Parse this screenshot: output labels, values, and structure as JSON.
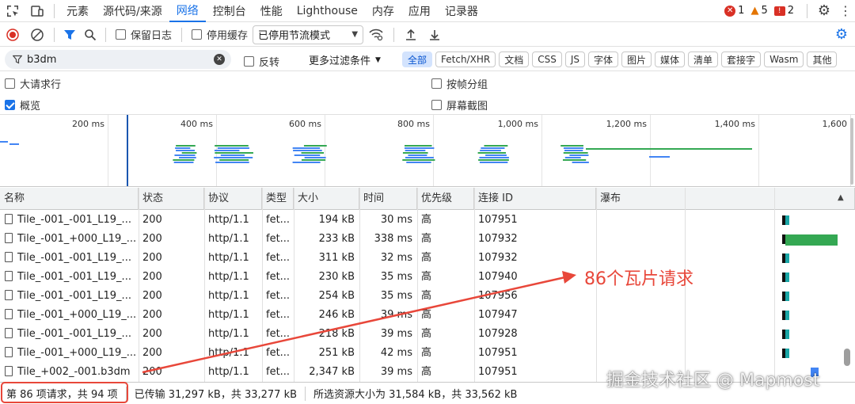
{
  "tabs": {
    "items": [
      "元素",
      "源代码/来源",
      "网络",
      "控制台",
      "性能",
      "Lighthouse",
      "内存",
      "应用",
      "记录器"
    ],
    "active_index": 2,
    "errors": "1",
    "warnings": "5",
    "issues": "2"
  },
  "toolbar": {
    "preserve_log": "保留日志",
    "disable_cache": "停用缓存",
    "throttling": "已停用节流模式"
  },
  "filter": {
    "value": "b3dm",
    "invert": "反转",
    "more_filters": "更多过滤条件",
    "types": [
      "全部",
      "Fetch/XHR",
      "文档",
      "CSS",
      "JS",
      "字体",
      "图片",
      "媒体",
      "清单",
      "套接字",
      "Wasm",
      "其他"
    ],
    "active_type": 0
  },
  "options": {
    "large_rows": "大请求行",
    "overview": "概览",
    "group_by_frame": "按帧分组",
    "screenshots": "屏幕截图",
    "large_rows_checked": false,
    "overview_checked": true,
    "group_by_frame_checked": false,
    "screenshots_checked": false
  },
  "overview_ticks": [
    "200 ms",
    "400 ms",
    "600 ms",
    "800 ms",
    "1,000 ms",
    "1,200 ms",
    "1,400 ms",
    "1,600"
  ],
  "table": {
    "headers": [
      "名称",
      "状态",
      "协议",
      "类型",
      "大小",
      "时间",
      "优先级",
      "连接 ID",
      "瀑布"
    ],
    "rows": [
      {
        "name": "Tile_-001_-001_L19_...",
        "status": "200",
        "protocol": "http/1.1",
        "type": "fet...",
        "size": "194 kB",
        "time": "30 ms",
        "priority": "高",
        "conn": "107951",
        "wf_green": 0
      },
      {
        "name": "Tile_-001_+000_L19_...",
        "status": "200",
        "protocol": "http/1.1",
        "type": "fet...",
        "size": "233 kB",
        "time": "338 ms",
        "priority": "高",
        "conn": "107932",
        "wf_green": 1
      },
      {
        "name": "Tile_-001_-001_L19_...",
        "status": "200",
        "protocol": "http/1.1",
        "type": "fet...",
        "size": "311 kB",
        "time": "32 ms",
        "priority": "高",
        "conn": "107932",
        "wf_green": 0
      },
      {
        "name": "Tile_-001_-001_L19_...",
        "status": "200",
        "protocol": "http/1.1",
        "type": "fet...",
        "size": "230 kB",
        "time": "35 ms",
        "priority": "高",
        "conn": "107940",
        "wf_green": 0
      },
      {
        "name": "Tile_-001_-001_L19_...",
        "status": "200",
        "protocol": "http/1.1",
        "type": "fet...",
        "size": "254 kB",
        "time": "35 ms",
        "priority": "高",
        "conn": "107956",
        "wf_green": 0
      },
      {
        "name": "Tile_-001_+000_L19_...",
        "status": "200",
        "protocol": "http/1.1",
        "type": "fet...",
        "size": "246 kB",
        "time": "39 ms",
        "priority": "高",
        "conn": "107947",
        "wf_green": 0
      },
      {
        "name": "Tile_-001_-001_L19_...",
        "status": "200",
        "protocol": "http/1.1",
        "type": "fet...",
        "size": "218 kB",
        "time": "39 ms",
        "priority": "高",
        "conn": "107928",
        "wf_green": 0
      },
      {
        "name": "Tile_-001_+000_L19_...",
        "status": "200",
        "protocol": "http/1.1",
        "type": "fet...",
        "size": "251 kB",
        "time": "42 ms",
        "priority": "高",
        "conn": "107951",
        "wf_green": 0
      },
      {
        "name": "Tile_+002_-001.b3dm",
        "status": "200",
        "protocol": "http/1.1",
        "type": "fet...",
        "size": "2,347 kB",
        "time": "39 ms",
        "priority": "高",
        "conn": "107951",
        "wf_green": 0
      }
    ]
  },
  "status": {
    "requests": "第 86 项请求，共 94 项",
    "transferred": "已传输 31,297 kB，共 33,277 kB",
    "resources": "所选资源大小为 31,584 kB，共 33,562 kB"
  },
  "annotation": {
    "text": "86个瓦片请求",
    "color": "#e8473a"
  },
  "watermark": "掘金技术社区 @ Mapmost",
  "colors": {
    "accent": "#1a73e8",
    "waterfall_green": "#34a853",
    "waterfall_teal": "#1aa6a6"
  }
}
